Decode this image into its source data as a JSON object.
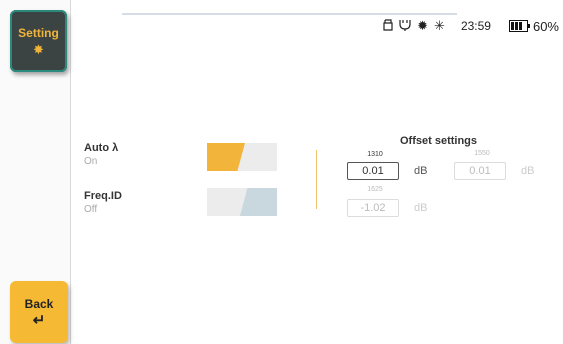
{
  "sidebar": {
    "setting_label": "Setting",
    "setting_icon": "gear-icon",
    "back_label": "Back",
    "back_icon": "return-arrow-icon"
  },
  "status_bar": {
    "icons": [
      "usb-icon",
      "plug-icon",
      "gear-status-icon",
      "laser-icon"
    ],
    "time": "23:59",
    "battery_percent": "60%",
    "battery_level": 0.6
  },
  "toggles": {
    "auto": {
      "title": "Auto λ",
      "state": "On",
      "enabled": true
    },
    "freq": {
      "title": "Freq.ID",
      "state": "Off",
      "enabled": false
    }
  },
  "offset": {
    "title": "Offset settings",
    "unit": "dB",
    "fields": [
      {
        "wavelength": "1310",
        "value": "0.01",
        "active": true
      },
      {
        "wavelength": "1550",
        "value": "0.01",
        "active": false
      },
      {
        "wavelength": "1625",
        "value": "-1.02",
        "active": false
      }
    ]
  },
  "colors": {
    "accent": "#f6b933",
    "toggle_on": "#f3b43c",
    "toggle_off": "#c9d8de",
    "setting_bg": "#3c4443",
    "setting_border": "#2a8a7e"
  }
}
